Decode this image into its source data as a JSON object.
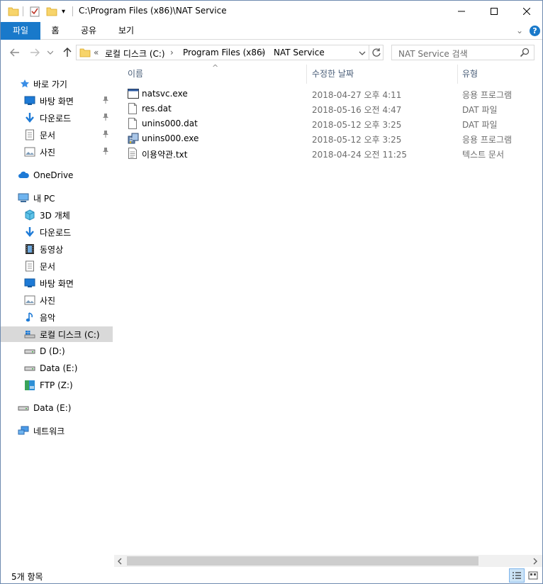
{
  "titlebar": {
    "path": "C:\\Program Files (x86)\\NAT Service",
    "qa_dropdown": "▾",
    "minimize": "—",
    "maximize": "☐",
    "close": "✕"
  },
  "ribbon": {
    "tabs": [
      "파일",
      "홈",
      "공유",
      "보기"
    ],
    "collapse": "⌄",
    "help": "?"
  },
  "address": {
    "overflow": "«",
    "crumbs": [
      "로컬 디스크 (C:)",
      "Program Files (x86)",
      "NAT Service"
    ],
    "separator": "›",
    "dropdown": "⌄",
    "search_placeholder": "NAT Service 검색"
  },
  "nav": {
    "quick_access": "바로 가기",
    "quick_items": [
      "바탕 화면",
      "다운로드",
      "문서",
      "사진"
    ],
    "onedrive": "OneDrive",
    "this_pc": "내 PC",
    "pc_items": [
      "3D 개체",
      "다운로드",
      "동영상",
      "문서",
      "바탕 화면",
      "사진",
      "음악",
      "로컬 디스크 (C:)",
      "D (D:)",
      "Data (E:)",
      "FTP (Z:)"
    ],
    "data_drive": "Data (E:)",
    "network": "네트워크"
  },
  "columns": {
    "name": "이름",
    "date": "수정한 날짜",
    "type": "유형",
    "sort_indicator": "^"
  },
  "files": [
    {
      "name": "natsvc.exe",
      "date": "2018-04-27 오후 4:11",
      "type": "응용 프로그램",
      "icon": "app-window-icon"
    },
    {
      "name": "res.dat",
      "date": "2018-05-16 오전 4:47",
      "type": "DAT 파일",
      "icon": "blank-file-icon"
    },
    {
      "name": "unins000.dat",
      "date": "2018-05-12 오후 3:25",
      "type": "DAT 파일",
      "icon": "blank-file-icon"
    },
    {
      "name": "unins000.exe",
      "date": "2018-05-12 오후 3:25",
      "type": "응용 프로그램",
      "icon": "installer-icon"
    },
    {
      "name": "이용약관.txt",
      "date": "2018-04-24 오전 11:25",
      "type": "텍스트 문서",
      "icon": "text-file-icon"
    }
  ],
  "status": {
    "count": "5개 항목"
  },
  "colors": {
    "accent": "#1979ca",
    "selected_nav": "#d9d9d9",
    "folder": "#f7d46b"
  }
}
